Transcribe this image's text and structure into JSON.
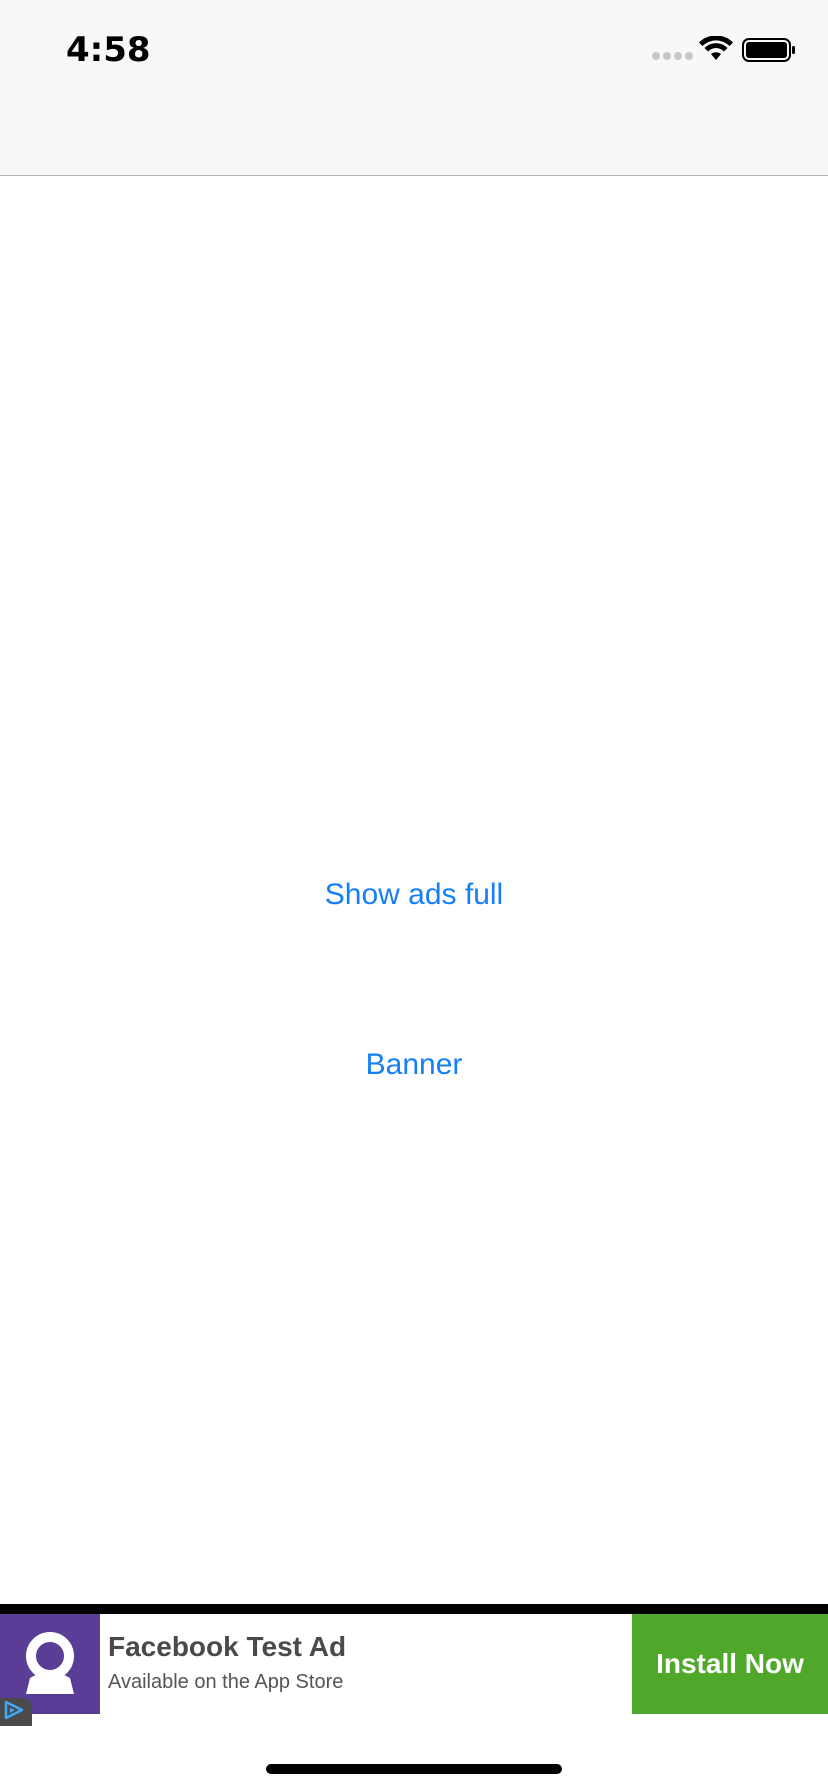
{
  "status_bar": {
    "time": "4:58"
  },
  "main": {
    "show_ads_full_label": "Show ads full",
    "banner_label": "Banner"
  },
  "ad_banner": {
    "title": "Facebook Test Ad",
    "subtitle": "Available on the App Store",
    "install_label": "Install Now",
    "logo_color": "#5a3d96",
    "install_color": "#4fa82a",
    "logo_icon": "user-avatar-icon",
    "ad_choices_icon": "ad-choices-icon"
  },
  "colors": {
    "link": "#147efb",
    "nav_background": "#f8f8f8"
  }
}
